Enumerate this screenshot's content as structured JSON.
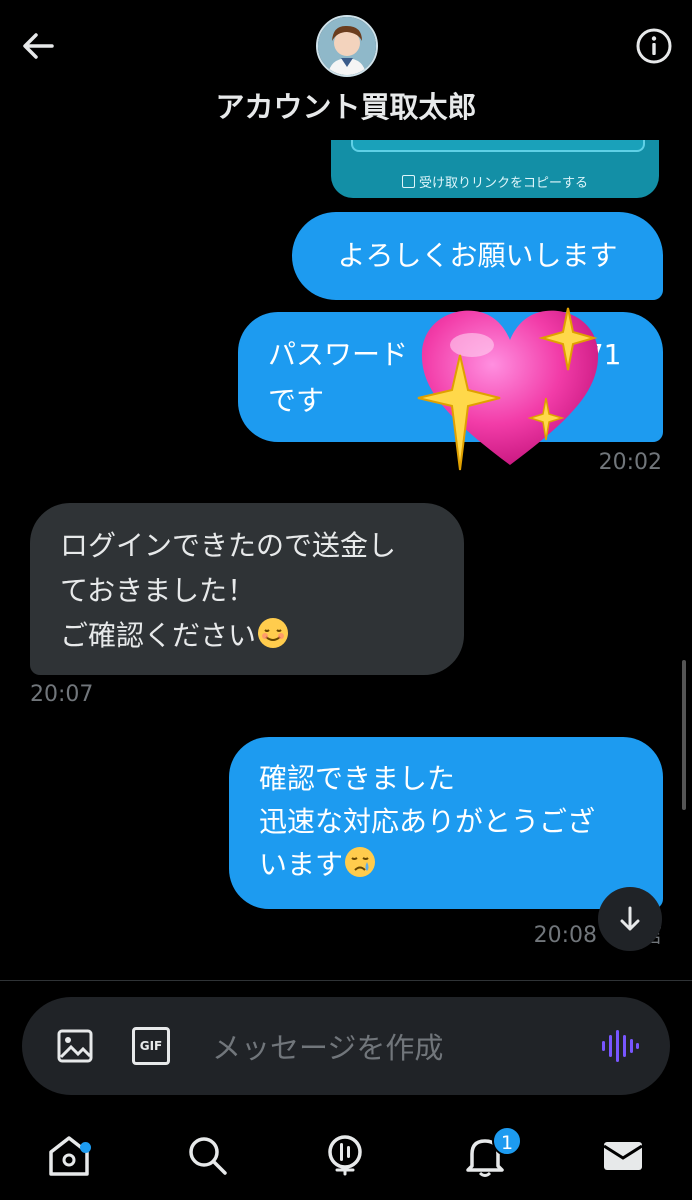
{
  "header": {
    "title": "アカウント買取太郎",
    "back_icon": "arrow-left-icon",
    "info_icon": "info-icon"
  },
  "card": {
    "link_label": "受け取りリンクをコピーする"
  },
  "messages": [
    {
      "direction": "out",
      "lines": [
        "よろしくお願いします"
      ]
    },
    {
      "direction": "out",
      "lines": [
        "パスワード",
        "571",
        "です"
      ],
      "sticker": "sparkling-heart-icon"
    },
    {
      "direction": "in",
      "lines": [
        "ログインできたので送金し",
        "ておきました！",
        "ご確認ください"
      ],
      "emoji": "smiling-face-icon"
    },
    {
      "direction": "out",
      "lines": [
        "確認できました",
        "迅速な対応ありがとうござ",
        "います"
      ],
      "emoji": "crying-face-icon"
    }
  ],
  "timestamps": {
    "t1": "20:02",
    "t2": "20:07",
    "t3": "20:08 · 送信"
  },
  "composer": {
    "placeholder": "メッセージを作成",
    "gif_label": "GIF"
  },
  "tabbar": {
    "notifications_badge": "1"
  },
  "colors": {
    "accent": "#1d9bf0",
    "incoming_bubble": "#2f3336",
    "background": "#000000",
    "voice_icon": "#7856ff"
  }
}
